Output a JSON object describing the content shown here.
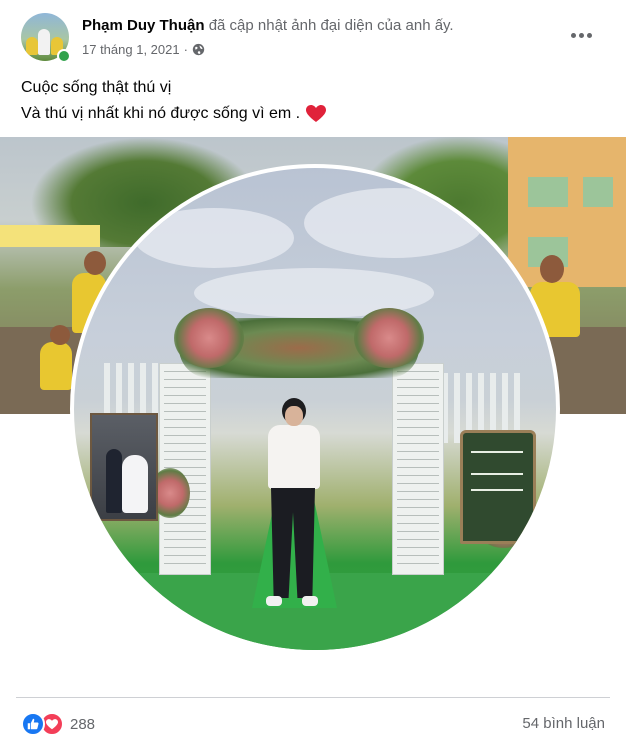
{
  "post": {
    "author": "Phạm Duy Thuận",
    "action": "đã cập nhật ảnh đại diện của anh ấy.",
    "date": "17 tháng 1, 2021",
    "separator": "·",
    "audience_icon": "globe-icon",
    "caption_line1": "Cuộc sống thật thú vị",
    "caption_line2": "Và thú vị nhất khi nó được sống vì em .",
    "caption_emoji": "red-heart-emoji"
  },
  "photo": {
    "description_icon": "profile-picture-photo"
  },
  "footer": {
    "reactions": [
      "like",
      "love"
    ],
    "reaction_count": "288",
    "comment_count": "54 bình luận"
  },
  "colors": {
    "like": "#1877f2",
    "love": "#f33e58",
    "online": "#31a24c",
    "secondary_text": "#65676b"
  }
}
